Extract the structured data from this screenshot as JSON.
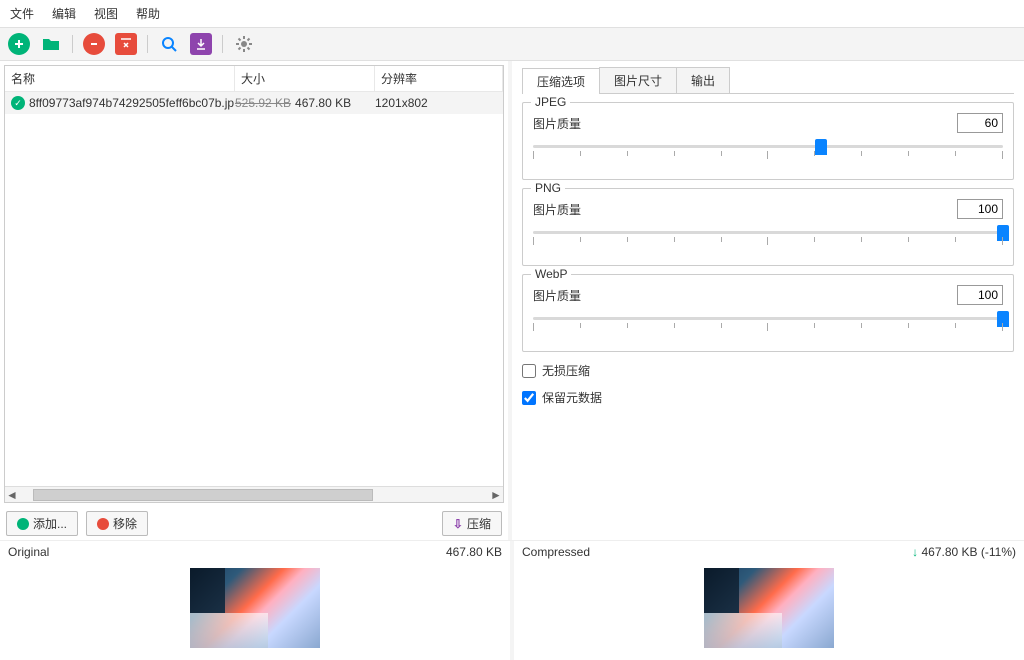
{
  "menu": {
    "file": "文件",
    "edit": "编辑",
    "view": "视图",
    "help": "帮助"
  },
  "table": {
    "headers": {
      "name": "名称",
      "size": "大小",
      "res": "分辨率"
    },
    "rows": [
      {
        "name": "8ff09773af974b74292505feff6bc07b.jp",
        "orig": "525.92 KB",
        "new": "467.80 KB",
        "res": "1201x802"
      }
    ]
  },
  "buttons": {
    "add": "添加...",
    "remove": "移除",
    "compress": "压缩"
  },
  "tabs": {
    "options": "压缩选项",
    "size": "图片尺寸",
    "output": "输出"
  },
  "groups": {
    "jpeg": {
      "title": "JPEG",
      "quality": "图片质量",
      "value": "60"
    },
    "png": {
      "title": "PNG",
      "quality": "图片质量",
      "value": "100"
    },
    "webp": {
      "title": "WebP",
      "quality": "图片质量",
      "value": "100"
    }
  },
  "checkboxes": {
    "lossless": "无损压缩",
    "metadata": "保留元数据"
  },
  "preview": {
    "original": {
      "label": "Original",
      "size": "467.80 KB"
    },
    "compressed": {
      "label": "Compressed",
      "size": "467.80 KB (-11%)"
    }
  }
}
